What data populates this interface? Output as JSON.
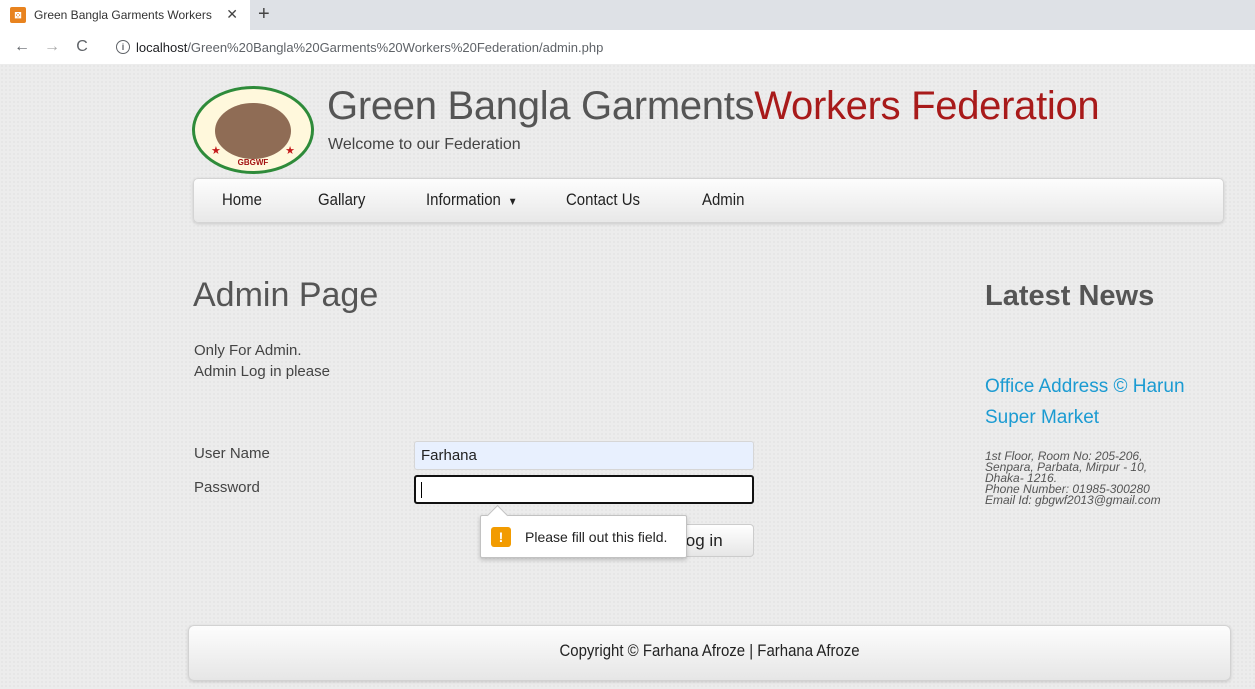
{
  "browser": {
    "tab_title": "Green Bangla Garments Workers",
    "favicon": "xampp-icon",
    "url_host": "localhost",
    "url_path": "/Green%20Bangla%20Garments%20Workers%20Federation/admin.php"
  },
  "site": {
    "title_main": "Green Bangla Garments",
    "title_accent": "Workers Federation",
    "tagline": "Welcome to our Federation",
    "logo_text": "GBGWF",
    "accent_color": "#a81a1a"
  },
  "nav": {
    "items": [
      "Home",
      "Gallary",
      "Information",
      "Contact Us",
      "Admin"
    ]
  },
  "admin": {
    "heading": "Admin Page",
    "desc_line1": "Only For Admin.",
    "desc_line2": "Admin Log in please",
    "username_label": "User Name",
    "username_value": "Farhana",
    "password_label": "Password",
    "password_value": "",
    "login_label": "Log in",
    "validation_message": "Please fill out this field."
  },
  "news": {
    "heading": "Latest News",
    "link_text": "Office Address © Harun Super Market",
    "detail_line1": "1st Floor, Room No: 205-206,",
    "detail_line2": "Senpara, Parbata, Mirpur - 10,",
    "detail_line3": "Dhaka- 1216.",
    "detail_line4": "Phone Number: 01985-300280",
    "detail_line5": "Email Id: gbgwf2013@gmail.com",
    "link_color": "#1b9bd2"
  },
  "footer": {
    "text": "Copyright © Farhana Afroze | Farhana Afroze"
  }
}
